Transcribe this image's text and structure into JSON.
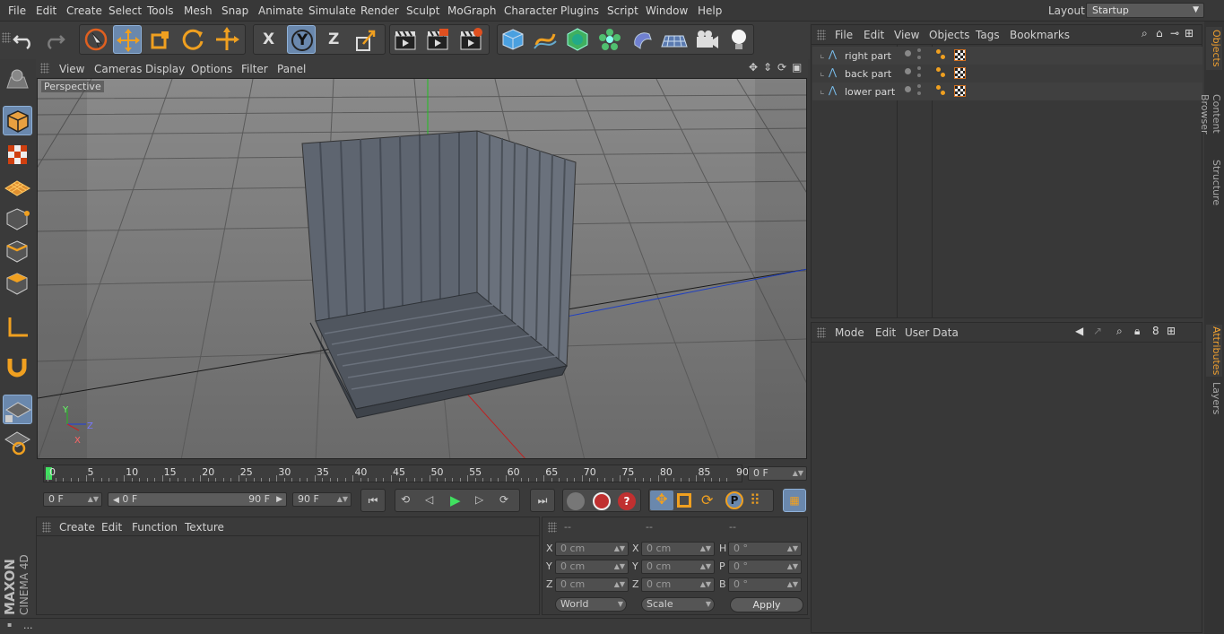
{
  "menu": [
    "File",
    "Edit",
    "Create",
    "Select",
    "Tools",
    "Mesh",
    "Snap",
    "Animate",
    "Simulate",
    "Render",
    "Sculpt",
    "MoGraph",
    "Character",
    "Plugins",
    "Script",
    "Window",
    "Help"
  ],
  "layout": {
    "label": "Layout:",
    "value": "Startup"
  },
  "toolbar": {
    "x_label": "X",
    "y_label": "Y",
    "z_label": "Z"
  },
  "viewport": {
    "menu": [
      "View",
      "Cameras",
      "Display",
      "Options",
      "Filter",
      "Panel"
    ],
    "label": "Perspective",
    "axis_x": "X",
    "axis_y": "Y",
    "axis_z": "Z"
  },
  "timeline": {
    "ticks": [
      "0",
      "5",
      "10",
      "15",
      "20",
      "25",
      "30",
      "35",
      "40",
      "45",
      "50",
      "55",
      "60",
      "65",
      "70",
      "75",
      "80",
      "85",
      "90"
    ],
    "current_frame": "0 F"
  },
  "transport": {
    "start": "0 F",
    "range_start": "0 F",
    "range_end": "90 F",
    "end": "90 F"
  },
  "materials": {
    "menu": [
      "Create",
      "Edit",
      "Function",
      "Texture"
    ]
  },
  "coords": {
    "headers": [
      "--",
      "--",
      "--"
    ],
    "rows": [
      {
        "a": "X",
        "av": "0 cm",
        "b": "X",
        "bv": "0 cm",
        "c": "H",
        "cv": "0 °"
      },
      {
        "a": "Y",
        "av": "0 cm",
        "b": "Y",
        "bv": "0 cm",
        "c": "P",
        "cv": "0 °"
      },
      {
        "a": "Z",
        "av": "0 cm",
        "b": "Z",
        "bv": "0 cm",
        "c": "B",
        "cv": "0 °"
      }
    ],
    "mode": "World",
    "scale": "Scale",
    "apply": "Apply"
  },
  "object_manager": {
    "menu": [
      "File",
      "Edit",
      "View",
      "Objects",
      "Tags",
      "Bookmarks"
    ],
    "objects": [
      "right part",
      "back part",
      "lower part"
    ]
  },
  "attributes": {
    "menu": [
      "Mode",
      "Edit",
      "User Data"
    ]
  },
  "right_tabs": [
    "Objects",
    "Content Browser",
    "Structure",
    "Attributes",
    "Layers"
  ],
  "brand": {
    "line1": "MAXON",
    "line2": "CINEMA 4D"
  },
  "status": "..."
}
